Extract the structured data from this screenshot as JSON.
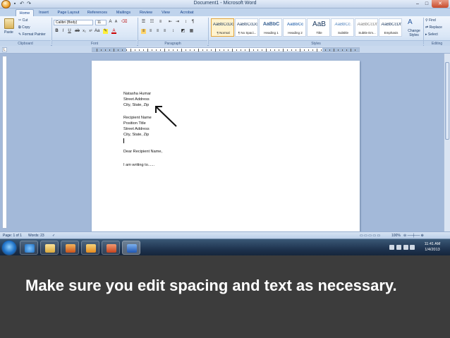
{
  "window": {
    "title": "Document1 - Microsoft Word",
    "minimize_icon": "minimize-icon",
    "maximize_icon": "maximize-icon",
    "close_icon": "close-icon"
  },
  "quick_access": {
    "save_icon": "save-icon",
    "undo_icon": "undo-icon",
    "redo_icon": "redo-icon"
  },
  "ribbon": {
    "tabs": [
      "Home",
      "Insert",
      "Page Layout",
      "References",
      "Mailings",
      "Review",
      "View",
      "Acrobat"
    ],
    "active_tab": "Home",
    "clipboard": {
      "paste": "Paste",
      "cut": "Cut",
      "copy": "Copy",
      "format_painter": "Format Painter",
      "group_label": "Clipboard"
    },
    "font": {
      "font_name": "Calibri (Body)",
      "font_size": "11",
      "group_label": "Font"
    },
    "paragraph": {
      "group_label": "Paragraph"
    },
    "styles": {
      "items": [
        {
          "sample": "AaBbCcDc",
          "name": "¶ Normal"
        },
        {
          "sample": "AaBbCcDc",
          "name": "¶ No Spaci..."
        },
        {
          "sample": "AaBbC",
          "name": "Heading 1"
        },
        {
          "sample": "AaBbCc",
          "name": "Heading 2"
        },
        {
          "sample": "AaB",
          "name": "Title"
        },
        {
          "sample": "AaBbCc.",
          "name": "Subtitle"
        },
        {
          "sample": "AaBbCcDt",
          "name": "Subtle Em..."
        },
        {
          "sample": "AaBbCcDt",
          "name": "Emphasis"
        }
      ],
      "change_styles": "Change Styles",
      "group_label": "Styles"
    },
    "editing": {
      "find": "Find",
      "replace": "Replace",
      "select": "Select",
      "group_label": "Editing"
    }
  },
  "document": {
    "lines": [
      "Natasha Humar",
      "Street Address",
      "City, State, Zip",
      "",
      "Recipient Name",
      "Position Title",
      "Street Address",
      "City, State, Zip",
      "",
      "",
      "Dear Recipient Name,",
      "",
      "I am writing to......"
    ]
  },
  "statusbar": {
    "page": "Page: 1 of 1",
    "words": "Words: 23",
    "zoom": "100%"
  },
  "taskbar": {
    "time": "11:41 AM",
    "date": "1/4/2013"
  },
  "caption": "Make sure you edit spacing and text as necessary."
}
